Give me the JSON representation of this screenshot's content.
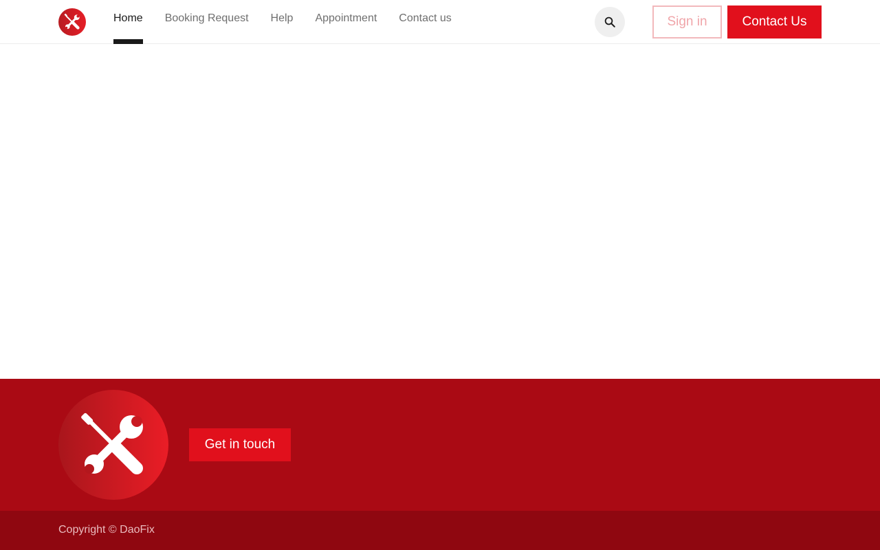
{
  "header": {
    "logo_icon": "tools-icon",
    "nav": [
      {
        "label": "Home",
        "active": true
      },
      {
        "label": "Booking Request",
        "active": false
      },
      {
        "label": "Help",
        "active": false
      },
      {
        "label": "Appointment",
        "active": false
      },
      {
        "label": "Contact us",
        "active": false
      }
    ],
    "search_icon": "search-icon",
    "signin_label": "Sign in",
    "contact_label": "Contact Us"
  },
  "footer": {
    "logo_icon": "tools-icon",
    "cta_label": "Get in touch",
    "copyright": "Copyright © DaoFix"
  },
  "colors": {
    "brand_red": "#e1101c",
    "footer_bg": "#aa0a14",
    "copyright_bg": "#8f0710",
    "active_nav": "#1a1a1a"
  }
}
